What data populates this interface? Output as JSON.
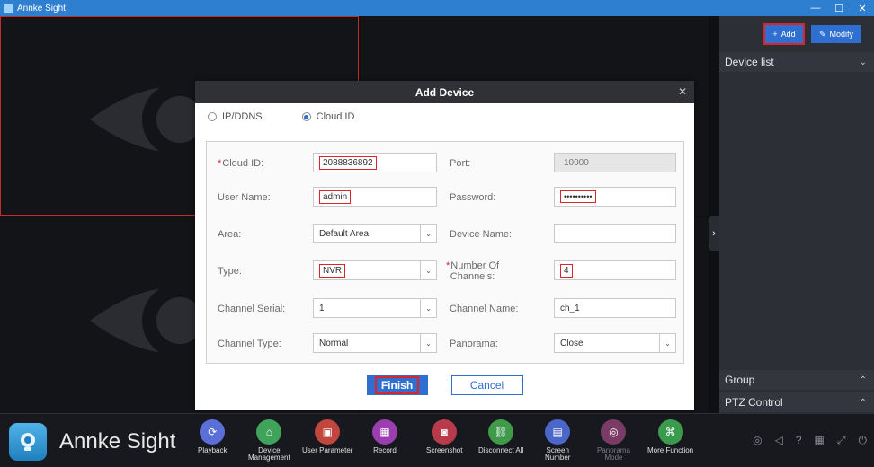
{
  "window": {
    "title": "Annke Sight",
    "minimize": "—",
    "maximize": "☐",
    "close": "✕"
  },
  "right_panel": {
    "add_label": "Add",
    "modify_label": "Modify",
    "device_list": "Device list",
    "group": "Group",
    "ptz": "PTZ Control"
  },
  "dialog": {
    "title": "Add Device",
    "radio_ip": "IP/DDNS",
    "radio_cloud": "Cloud ID",
    "selected_mode": "Cloud ID",
    "fields": {
      "cloud_id_label": "Cloud ID:",
      "cloud_id_value": "2088836892",
      "port_label": "Port:",
      "port_value": "10000",
      "user_label": "User Name:",
      "user_value": "admin",
      "password_label": "Password:",
      "password_value": "••••••••••",
      "area_label": "Area:",
      "area_value": "Default Area",
      "device_name_label": "Device Name:",
      "device_name_value": "",
      "type_label": "Type:",
      "type_value": "NVR",
      "channels_label_1": "Number Of",
      "channels_label_2": "Channels:",
      "channels_value": "4",
      "serial_label": "Channel Serial:",
      "serial_value": "1",
      "channel_name_label": "Channel Name:",
      "channel_name_value": "ch_1",
      "channel_type_label": "Channel Type:",
      "channel_type_value": "Normal",
      "panorama_label": "Panorama:",
      "panorama_value": "Close"
    },
    "finish": "Finish",
    "cancel": "Cancel"
  },
  "toolbar": {
    "brand": "Annke Sight",
    "items": [
      {
        "label1": "Playback",
        "label2": "",
        "color": "#5a6fd8",
        "glyph": "⟳"
      },
      {
        "label1": "Device",
        "label2": "Management",
        "color": "#3fa35a",
        "glyph": "⌂"
      },
      {
        "label1": "User Parameter",
        "label2": "",
        "color": "#c0463e",
        "glyph": "▣"
      },
      {
        "label1": "Record",
        "label2": "",
        "color": "#9b3fb0",
        "glyph": "▦"
      },
      {
        "label1": "Screenshot",
        "label2": "",
        "color": "#b83b4c",
        "glyph": "◙"
      },
      {
        "label1": "Disconnect All",
        "label2": "",
        "color": "#3f9a4a",
        "glyph": "⛓"
      },
      {
        "label1": "Screen",
        "label2": "Number",
        "color": "#4c67c9",
        "glyph": "▤"
      },
      {
        "label1": "Panorama",
        "label2": "Mode",
        "color": "#7a3b66",
        "glyph": "◎"
      },
      {
        "label1": "More Function",
        "label2": "",
        "color": "#3b9a4c",
        "glyph": "⌘"
      }
    ]
  }
}
